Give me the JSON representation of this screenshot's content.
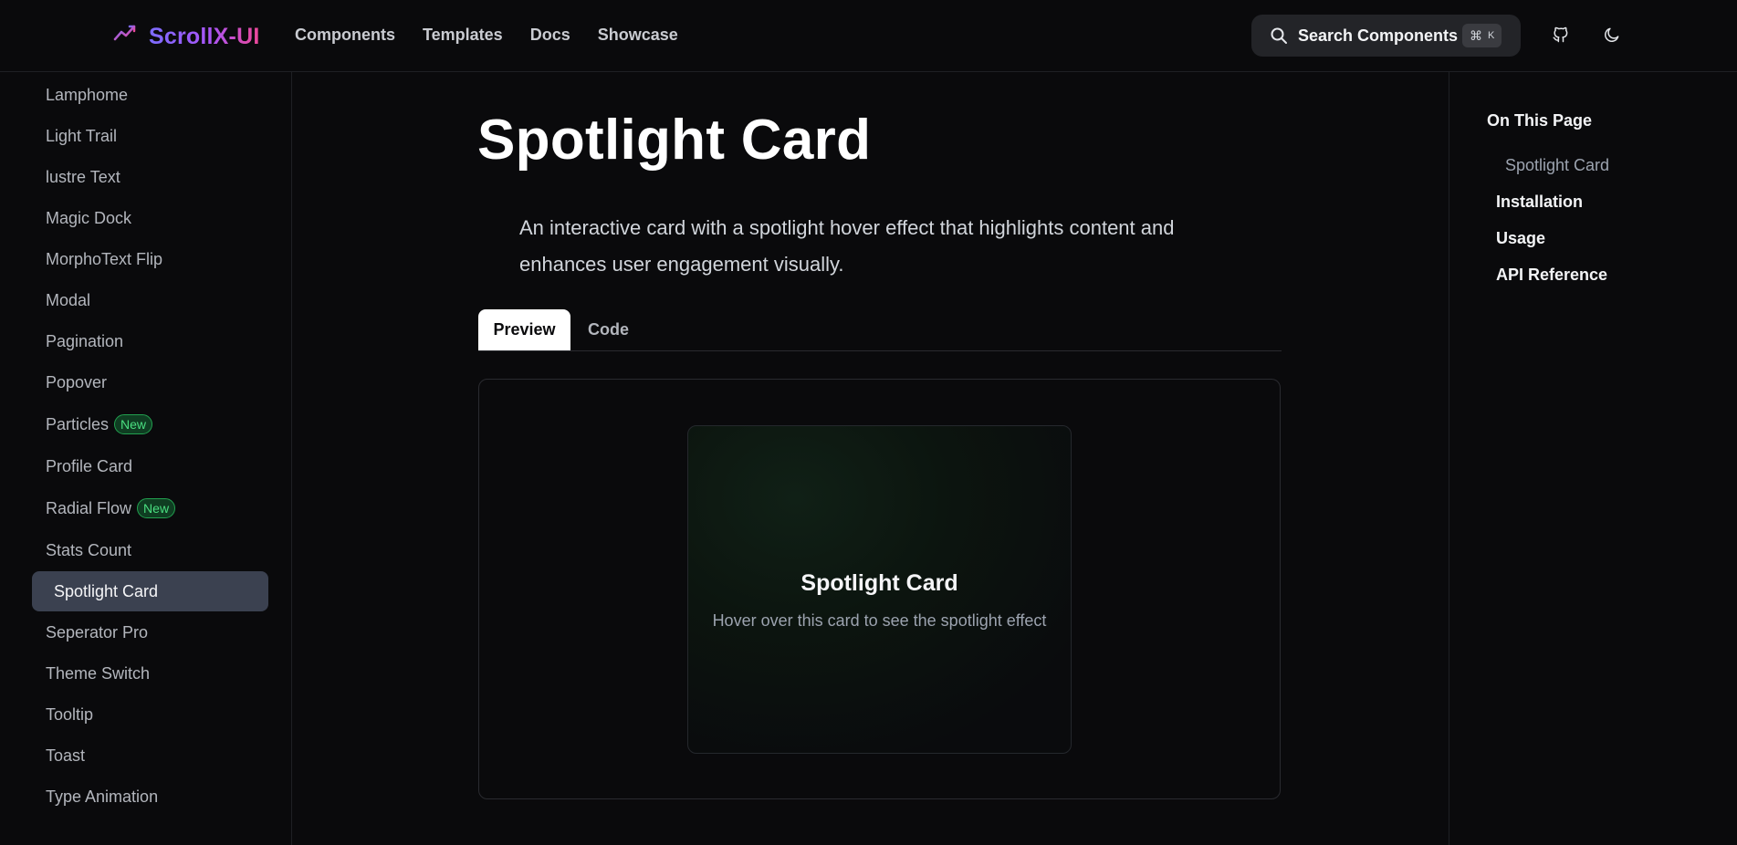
{
  "header": {
    "brand": "ScrollX-UI",
    "nav": [
      "Components",
      "Templates",
      "Docs",
      "Showcase"
    ],
    "search_label": "Search Components",
    "shortcut_symbol": "⌘",
    "shortcut_key": "K"
  },
  "sidebar": {
    "items": [
      {
        "label": "Lamphome"
      },
      {
        "label": "Light Trail"
      },
      {
        "label": "lustre Text"
      },
      {
        "label": "Magic Dock"
      },
      {
        "label": "MorphoText Flip"
      },
      {
        "label": "Modal"
      },
      {
        "label": "Pagination"
      },
      {
        "label": "Popover"
      },
      {
        "label": "Particles",
        "badge": "New"
      },
      {
        "label": "Profile Card"
      },
      {
        "label": "Radial Flow",
        "badge": "New"
      },
      {
        "label": "Stats Count"
      },
      {
        "label": "Spotlight Card",
        "active": true
      },
      {
        "label": "Seperator Pro"
      },
      {
        "label": "Theme Switch"
      },
      {
        "label": "Tooltip"
      },
      {
        "label": "Toast"
      },
      {
        "label": "Type Animation"
      }
    ]
  },
  "main": {
    "title": "Spotlight Card",
    "description": "An interactive card with a spotlight hover effect that highlights content and enhances user engagement visually.",
    "tabs": [
      "Preview",
      "Code"
    ],
    "card": {
      "title": "Spotlight Card",
      "subtitle": "Hover over this card to see the spotlight effect"
    }
  },
  "toc": {
    "title": "On This Page",
    "items": [
      {
        "label": "Spotlight Card"
      },
      {
        "label": "Installation"
      },
      {
        "label": "Usage"
      },
      {
        "label": "API Reference"
      }
    ]
  },
  "colors": {
    "background": "#0a0a0c",
    "active_item": "#3b4150",
    "badge_green": "#4ade80",
    "brand_gradient_start": "#7c6cff",
    "brand_gradient_end": "#ec4899"
  }
}
